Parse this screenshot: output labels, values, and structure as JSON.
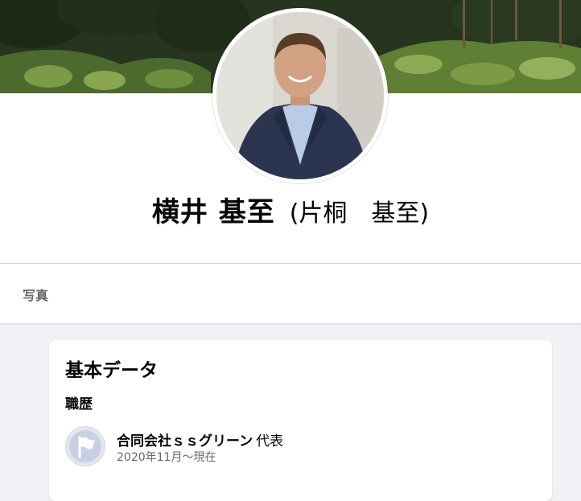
{
  "profile": {
    "name": "横井 基至",
    "alternate_name": "(片桐　基至)"
  },
  "tabs": [
    {
      "label": "写真"
    }
  ],
  "about": {
    "title": "基本データ",
    "work_section_title": "職歴",
    "work": [
      {
        "company": "合同会社ｓｓグリーン",
        "role": "代表",
        "period": "2020年11月～現在",
        "icon": "flag-icon"
      }
    ]
  },
  "colors": {
    "page_background": "#f0f2f5",
    "card_background": "#ffffff",
    "primary_text": "#050505",
    "secondary_text": "#65676b",
    "divider": "#ced0d4"
  }
}
